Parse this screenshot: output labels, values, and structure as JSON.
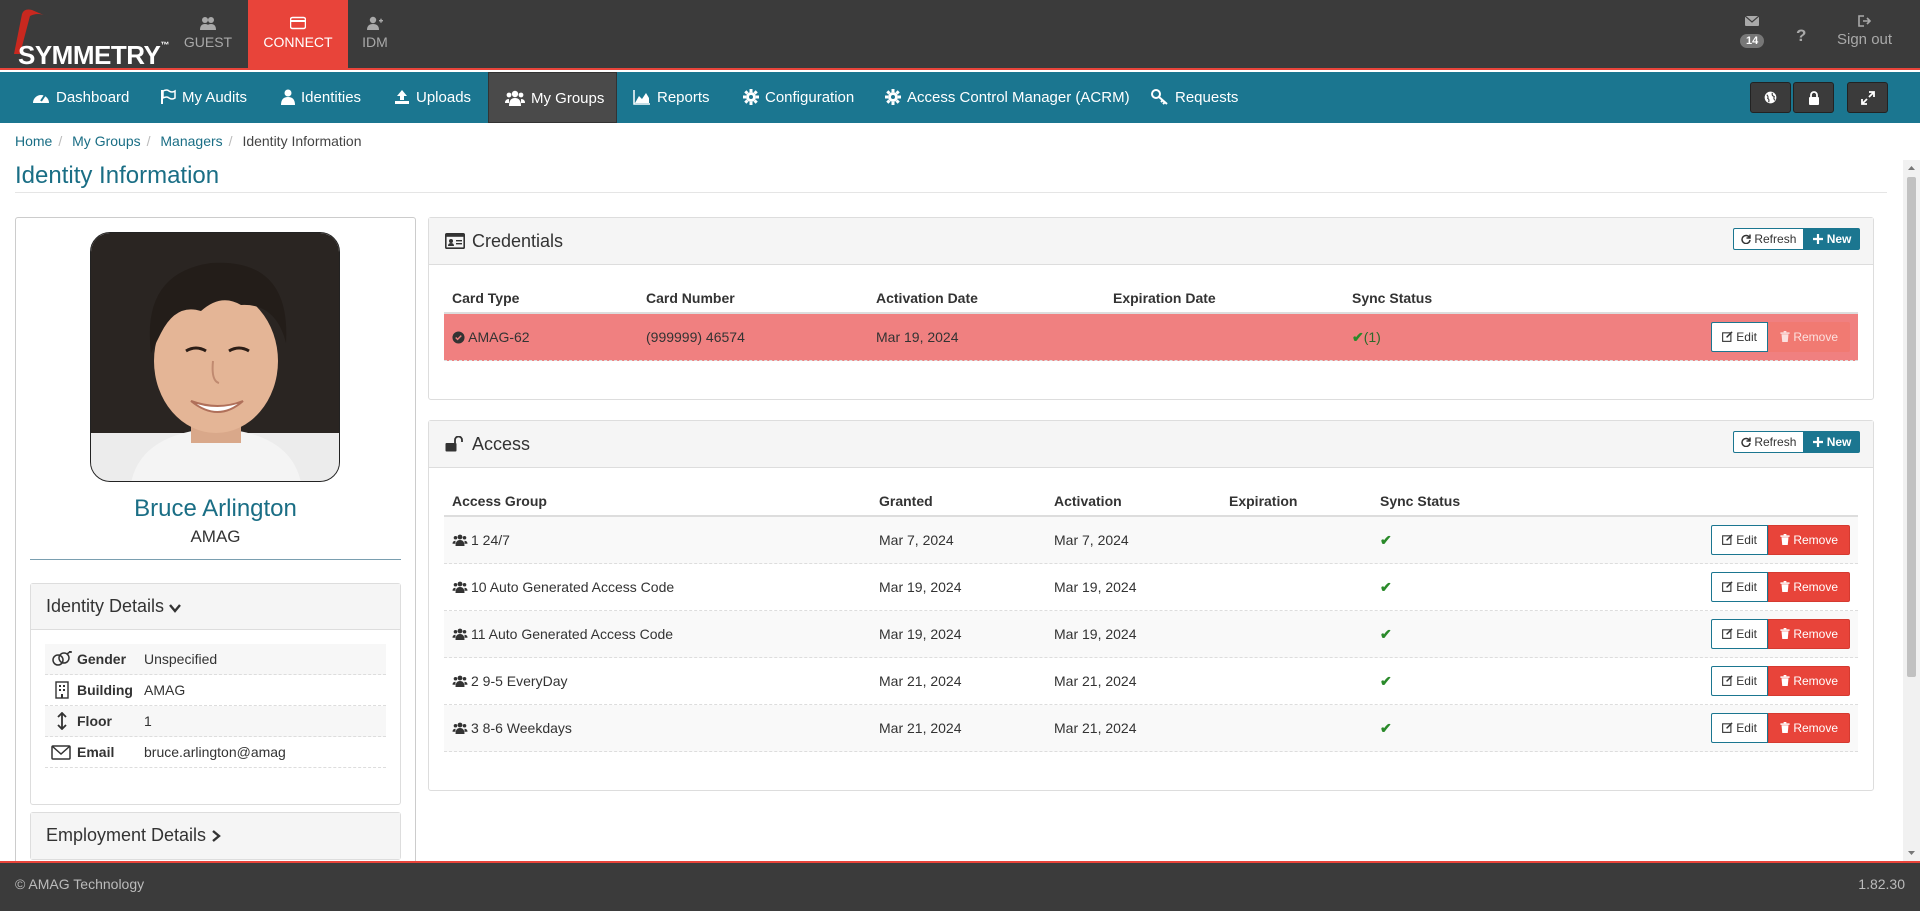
{
  "app": {
    "logo_text": "SYMMETRY",
    "logo_tm": "™",
    "top_tabs": [
      "GUEST",
      "CONNECT",
      "IDM"
    ],
    "message_count": "14",
    "help": "?",
    "sign_out": "Sign out"
  },
  "nav": {
    "items": [
      "Dashboard",
      "My Audits",
      "Identities",
      "Uploads",
      "My Groups",
      "Reports",
      "Configuration",
      "Access Control Manager (ACRM)",
      "Requests"
    ],
    "active": "My Groups"
  },
  "breadcrumb": [
    "Home",
    "My Groups",
    "Managers",
    "Identity Information"
  ],
  "page_title": "Identity Information",
  "person": {
    "name": "Bruce Arlington",
    "org": "AMAG"
  },
  "identity_details": {
    "title": "Identity Details",
    "rows": [
      {
        "label": "Gender",
        "value": "Unspecified"
      },
      {
        "label": "Building",
        "value": "AMAG"
      },
      {
        "label": "Floor",
        "value": "1"
      },
      {
        "label": "Email",
        "value": "bruce.arlington@amag"
      }
    ]
  },
  "employment_details": {
    "title": "Employment Details"
  },
  "buttons": {
    "refresh": "Refresh",
    "new": "New",
    "edit": "Edit",
    "remove": "Remove"
  },
  "credentials": {
    "title": "Credentials",
    "headers": [
      "Card Type",
      "Card Number",
      "Activation Date",
      "Expiration Date",
      "Sync Status"
    ],
    "rows": [
      {
        "card_type": "AMAG-62",
        "card_number": "(999999) 46574",
        "activation": "Mar 19, 2024",
        "expiration": "",
        "sync": "(1)"
      }
    ]
  },
  "access": {
    "title": "Access",
    "headers": [
      "Access Group",
      "Granted",
      "Activation",
      "Expiration",
      "Sync Status"
    ],
    "rows": [
      {
        "group": "1 24/7",
        "granted": "Mar 7, 2024",
        "activation": "Mar 7, 2024",
        "expiration": ""
      },
      {
        "group": "10 Auto Generated Access Code",
        "granted": "Mar 19, 2024",
        "activation": "Mar 19, 2024",
        "expiration": ""
      },
      {
        "group": "11 Auto Generated Access Code",
        "granted": "Mar 19, 2024",
        "activation": "Mar 19, 2024",
        "expiration": ""
      },
      {
        "group": "2 9-5 EveryDay",
        "granted": "Mar 21, 2024",
        "activation": "Mar 21, 2024",
        "expiration": ""
      },
      {
        "group": "3 8-6 Weekdays",
        "granted": "Mar 21, 2024",
        "activation": "Mar 21, 2024",
        "expiration": ""
      }
    ]
  },
  "footer": {
    "copyright": "© AMAG Technology",
    "version": "1.82.30"
  },
  "colors": {
    "brand_red": "#e8443a",
    "nav_teal": "#1b7690",
    "topbar_dark": "#3b3b3b",
    "danger_row": "#f08080",
    "success_green": "#2a8a2a"
  }
}
